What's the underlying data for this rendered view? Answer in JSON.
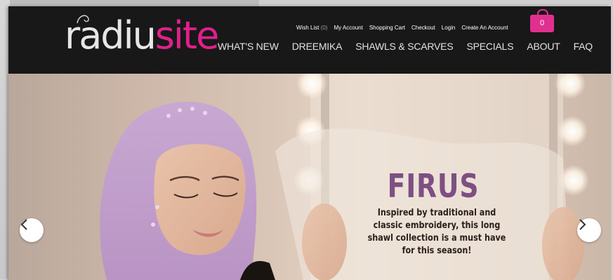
{
  "header": {
    "logo": {
      "part_a": "radiu",
      "part_b": "site"
    },
    "utility_links": [
      {
        "label": "Wish List",
        "count": "(0)"
      },
      {
        "label": "My Account"
      },
      {
        "label": "Shopping Cart"
      },
      {
        "label": "Checkout"
      },
      {
        "label": "Login"
      },
      {
        "label": "Create An Account"
      }
    ],
    "cart": {
      "icon": "shopping-bag-icon",
      "count": "0"
    },
    "main_nav": [
      "WHAT'S NEW",
      "DREEMIKA",
      "SHAWLS & SCARVES",
      "SPECIALS",
      "ABOUT",
      "FAQ"
    ]
  },
  "hero": {
    "title": "FIRUS",
    "description": "Inspired by traditional and classic embroidery, this long shawl collection is a must have for this season!",
    "prev_icon": "chevron-left-icon",
    "next_icon": "chevron-right-icon"
  },
  "colors": {
    "brand_pink": "#e0208c",
    "header_bg": "#181818",
    "title_purple": "#7d4f83"
  }
}
